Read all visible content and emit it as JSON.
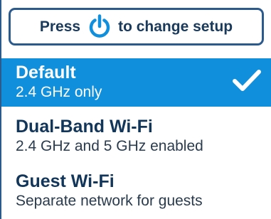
{
  "header": {
    "prefix": "Press",
    "suffix": "to change setup",
    "icon": "power-icon"
  },
  "options": [
    {
      "title": "Default",
      "subtitle": "2.4 GHz only",
      "selected": true
    },
    {
      "title": "Dual-Band Wi-Fi",
      "subtitle": "2.4 GHz and 5 GHz enabled",
      "selected": false
    },
    {
      "title": "Guest Wi-Fi",
      "subtitle": "Separate network for guests",
      "selected": false
    }
  ],
  "colors": {
    "accent": "#0f8fdc",
    "border": "#2b5a8c",
    "text_dark": "#12355a"
  }
}
